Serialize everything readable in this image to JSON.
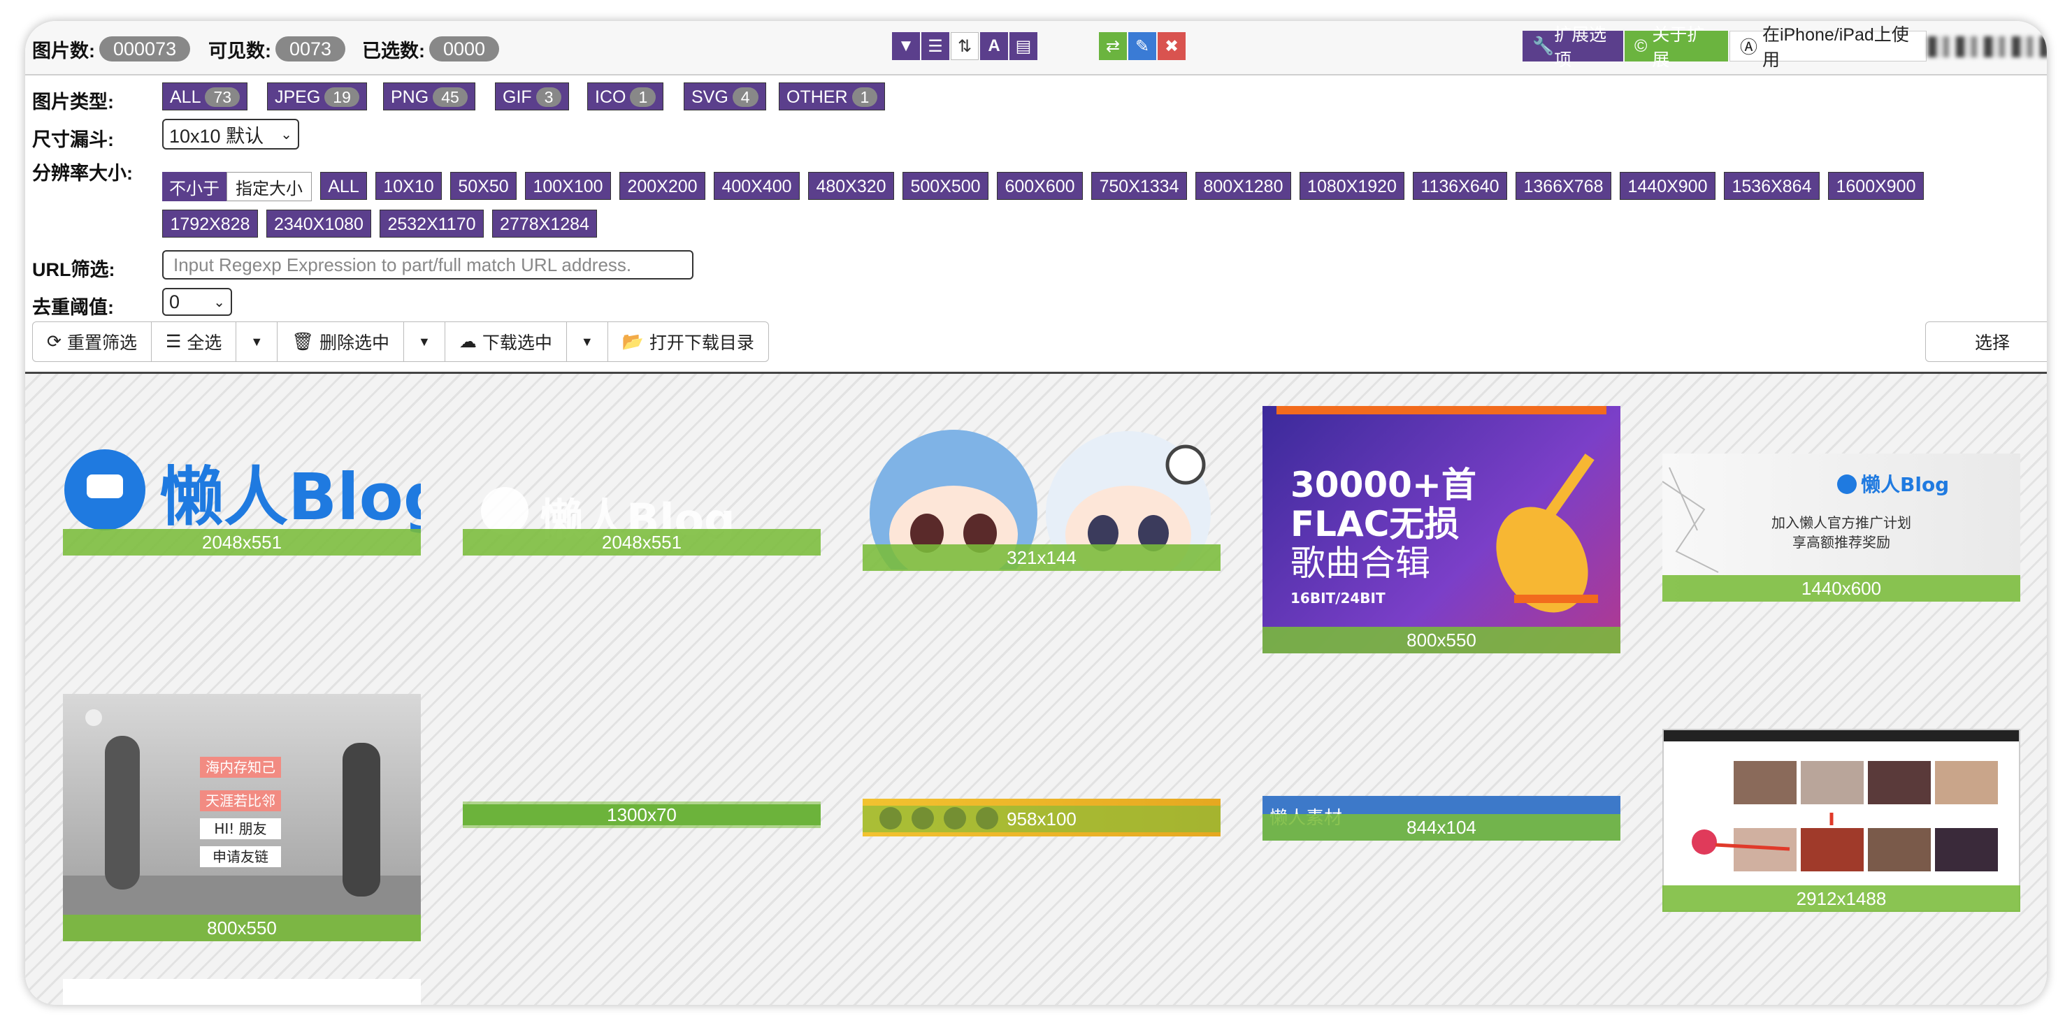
{
  "stats": {
    "total_label": "图片数:",
    "total_value": "000073",
    "visible_label": "可见数:",
    "visible_value": "0073",
    "selected_label": "已选数:",
    "selected_value": "0000"
  },
  "toolbar_icons": [
    "filter-icon",
    "list-icon",
    "sort-icon",
    "font-icon",
    "layout-icon",
    "swap-icon",
    "bookmark-icon",
    "close-icon"
  ],
  "extension": {
    "options_label": "扩展选项",
    "about_label": "关于扩展",
    "ios_label": "在iPhone/iPad上使用"
  },
  "filters": {
    "type_label": "图片类型:",
    "types": [
      {
        "label": "ALL",
        "count": "73"
      },
      {
        "label": "JPEG",
        "count": "19"
      },
      {
        "label": "PNG",
        "count": "45"
      },
      {
        "label": "GIF",
        "count": "3"
      },
      {
        "label": "ICO",
        "count": "1"
      },
      {
        "label": "SVG",
        "count": "4"
      },
      {
        "label": "OTHER",
        "count": "1"
      }
    ],
    "size_funnel_label": "尺寸漏斗:",
    "size_funnel_value": "10x10 默认",
    "resolution_label": "分辨率大小:",
    "resolution_mode_on": "不小于",
    "resolution_mode_off": "指定大小",
    "resolutions": [
      "ALL",
      "10X10",
      "50X50",
      "100X100",
      "200X200",
      "400X400",
      "480X320",
      "500X500",
      "600X600",
      "750X1334",
      "800X1280",
      "1080X1920",
      "1136X640",
      "1366X768",
      "1440X900",
      "1536X864",
      "1600X900",
      "1792X828",
      "2340X1080",
      "2532X1170",
      "2778X1284"
    ],
    "url_label": "URL筛选:",
    "url_placeholder": "Input Regexp Expression to part/full match URL address.",
    "dedupe_label": "去重阈值:",
    "dedupe_value": "0"
  },
  "actions": {
    "reset": "重置筛选",
    "select_all": "全选",
    "delete_selected": "删除选中",
    "download_selected": "下载选中",
    "open_download_dir": "打开下载目录",
    "select": "选择"
  },
  "images": [
    {
      "size": "2048x551",
      "kind": "logo-blue",
      "logo_text": "懒人Blog"
    },
    {
      "size": "2048x551",
      "kind": "logo-white",
      "logo_text": "懒人Blog"
    },
    {
      "size": "321x144",
      "kind": "anime"
    },
    {
      "size": "800x550",
      "kind": "flac",
      "line1": "30000+首",
      "line2": "FLAC无损",
      "line3": "歌曲合辑",
      "line4": "16BIT/24BIT"
    },
    {
      "size": "1440x600",
      "kind": "blog-banner",
      "logo_text": "懒人Blog",
      "line1": "加入懒人官方推广计划",
      "line2": "享高额推荐奖励"
    },
    {
      "size": "800x550",
      "kind": "photo-bw",
      "tag1": "海内存知己",
      "tag2": "天涯若比邻",
      "tag3": "HI! 朋友",
      "tag4": "申请友链"
    },
    {
      "size": "1300x70",
      "kind": "strip-green"
    },
    {
      "size": "958x100",
      "kind": "strip-yellow"
    },
    {
      "size": "844x104",
      "kind": "strip-blue",
      "text": "懒人素材"
    },
    {
      "size": "2912x1488",
      "kind": "screenshot"
    }
  ],
  "colors": {
    "accent": "#5b3f8c",
    "caption": "#7abc3a",
    "pill": "#888888"
  }
}
